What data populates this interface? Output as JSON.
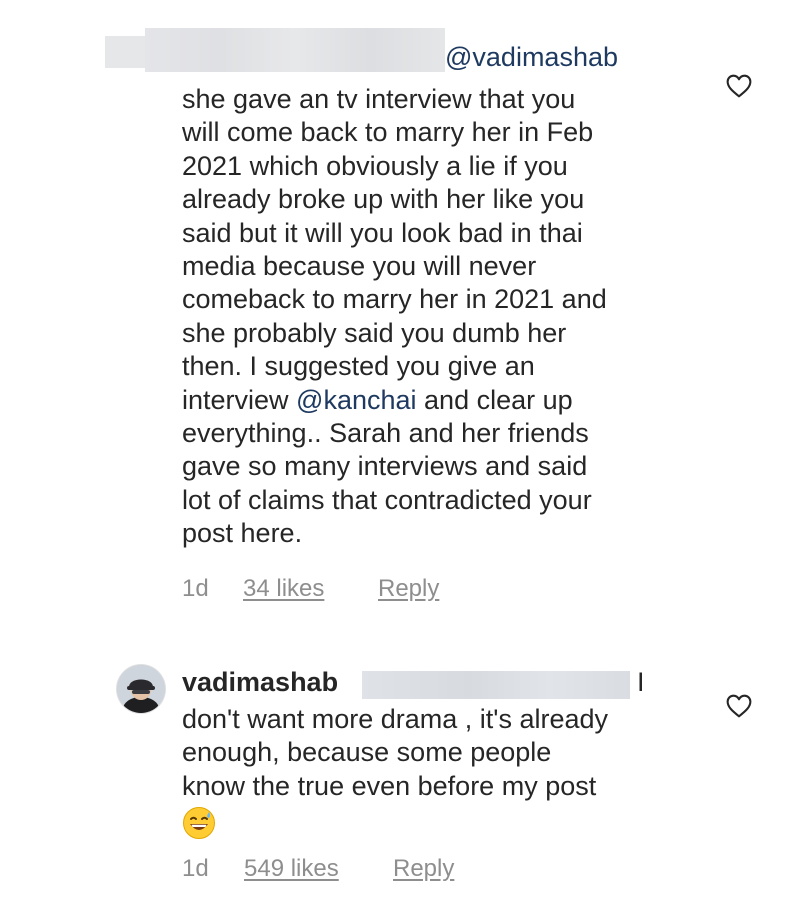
{
  "comments": [
    {
      "mention": "@vadimashab",
      "lines": [
        "she gave an tv interview that you",
        "will come back to marry her in Feb",
        "2021 which obviously a lie if you",
        "already broke up with her  like you",
        "said but it will you look bad in thai",
        "media because you will never",
        "comeback to marry her in 2021 and",
        "she probably said you dumb her",
        "then. I suggested you give an"
      ],
      "line10_before": "interview ",
      "line10_mention": "@kanchai",
      "line10_after": " and clear up",
      "lines_end": [
        "everything.. Sarah and her friends",
        "gave so many interviews and said",
        "lot of claims that contradicted your",
        "post here."
      ],
      "time_ago": "1d",
      "likes": "34 likes",
      "reply_label": "Reply",
      "like_icon": "heart-outline-icon"
    },
    {
      "username": "vadimashab",
      "first_line_tail": "I",
      "lines": [
        "don't want more drama , it's already",
        "enough, because some people",
        "know the true even before my post"
      ],
      "emoji": "grinning-face-with-sweat",
      "time_ago": "1d",
      "likes": "549 likes",
      "reply_label": "Reply",
      "like_icon": "heart-outline-icon"
    }
  ],
  "colors": {
    "text": "#262626",
    "mention": "#1f3a60",
    "meta": "#8e8e8e",
    "redaction": "#dcdde0"
  }
}
